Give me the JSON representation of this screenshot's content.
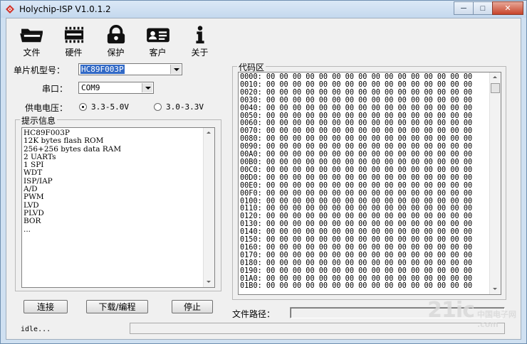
{
  "window": {
    "title": "Holychip-ISP V1.0.1.2",
    "min_glyph": "─",
    "max_glyph": "□",
    "close_glyph": "✕"
  },
  "toolbar": [
    {
      "label": "文件",
      "icon": "folder-icon"
    },
    {
      "label": "硬件",
      "icon": "chip-icon"
    },
    {
      "label": "保护",
      "icon": "lock-icon"
    },
    {
      "label": "客户",
      "icon": "id-card-icon"
    },
    {
      "label": "关于",
      "icon": "info-icon"
    }
  ],
  "form": {
    "chip_label": "单片机型号：",
    "chip_value": "HC89F003P",
    "port_label": "串口：",
    "port_value": "COM9",
    "voltage_label": "供电电压：",
    "voltage_options": [
      "3.3-5.0V",
      "3.0-3.3V"
    ],
    "voltage_selected": 0
  },
  "info": {
    "title": "提示信息",
    "lines": [
      "HC89F003P",
      "12K bytes flash ROM",
      "256+256 bytes data RAM",
      "2 UARTs",
      "1 SPI",
      "WDT",
      "ISP/IAP",
      "A/D",
      "PWM",
      "LVD",
      "PLVD",
      "BOR",
      "..."
    ]
  },
  "code": {
    "title": "代码区",
    "addresses": [
      "0000",
      "0010",
      "0020",
      "0030",
      "0040",
      "0050",
      "0060",
      "0070",
      "0080",
      "0090",
      "00A0",
      "00B0",
      "00C0",
      "00D0",
      "00E0",
      "00F0",
      "0100",
      "0110",
      "0120",
      "0130",
      "0140",
      "0150",
      "0160",
      "0170",
      "0180",
      "0190",
      "01A0",
      "01B0"
    ],
    "byte": "00",
    "bytes_per_row": 16
  },
  "buttons": {
    "connect": "连接",
    "download": "下载/编程",
    "stop": "停止"
  },
  "file_path": {
    "label": "文件路径：",
    "value": ""
  },
  "status": {
    "text": "idle...",
    "progress": 0
  },
  "watermark": {
    "big": "21ic",
    "small_top": "中国电子网",
    "small_bottom": ".com"
  },
  "colors": {
    "selection": "#3169c6",
    "window_frame": "#cfe0f1"
  }
}
